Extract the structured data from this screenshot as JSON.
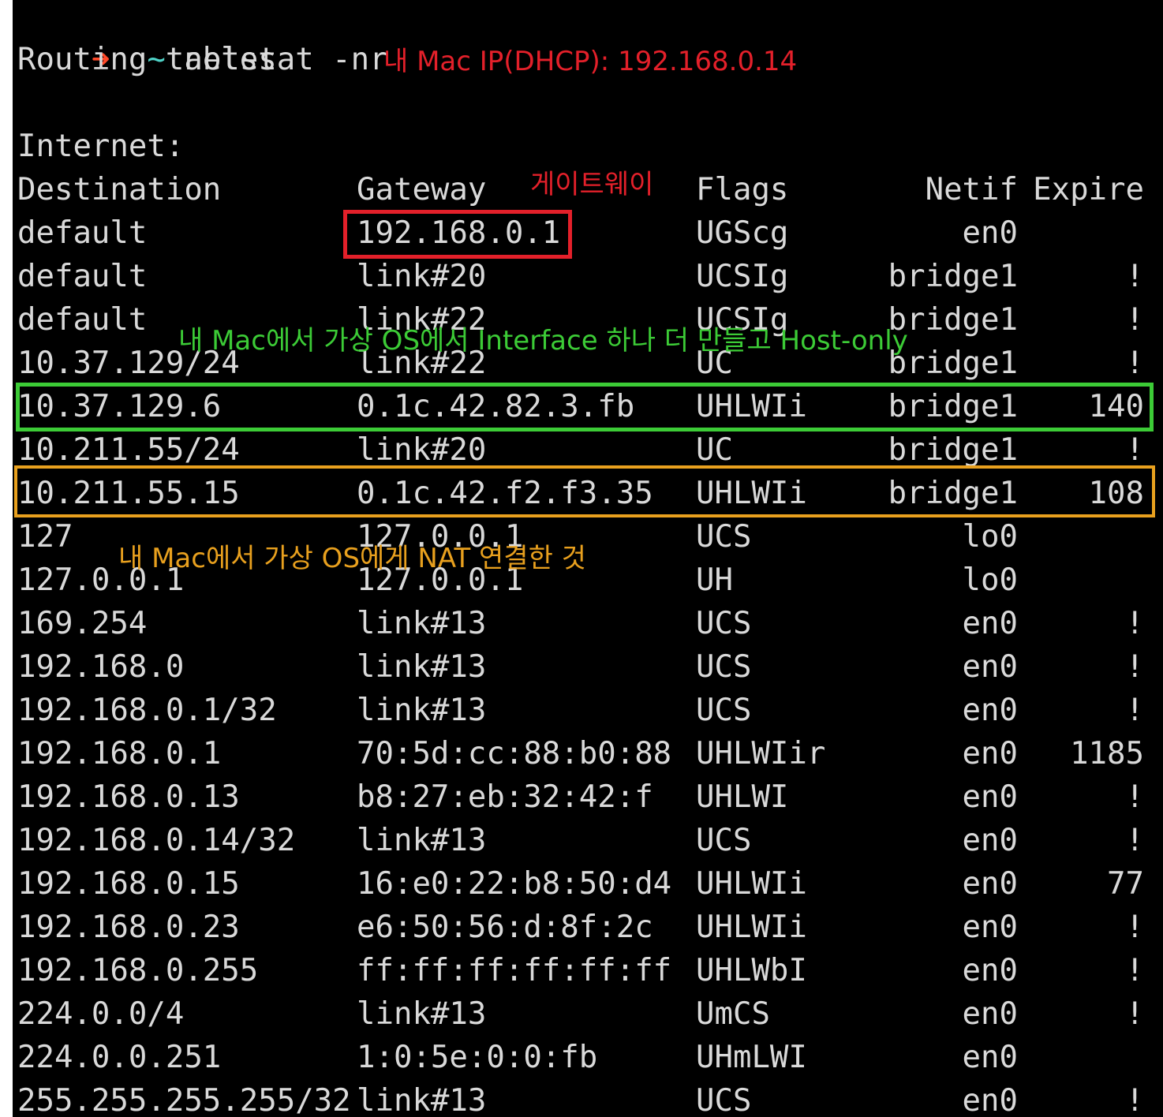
{
  "prompt": {
    "arrow": "➜",
    "tilde": "~",
    "command": "netstat -nr"
  },
  "heading": "Routing tables",
  "section": "Internet:",
  "columns": {
    "destination": "Destination",
    "gateway": "Gateway",
    "flags": "Flags",
    "netif": "Netif",
    "expire": "Expire"
  },
  "rows": [
    {
      "dest": "default",
      "gw": "192.168.0.1",
      "flags": "UGScg",
      "netif": "en0",
      "expire": ""
    },
    {
      "dest": "default",
      "gw": "link#20",
      "flags": "UCSIg",
      "netif": "bridge1",
      "expire": "!"
    },
    {
      "dest": "default",
      "gw": "link#22",
      "flags": "UCSIg",
      "netif": "bridge1",
      "expire": "!"
    },
    {
      "dest": "10.37.129/24",
      "gw": "link#22",
      "flags": "UC",
      "netif": "bridge1",
      "expire": "!"
    },
    {
      "dest": "10.37.129.6",
      "gw": "0.1c.42.82.3.fb",
      "flags": "UHLWIi",
      "netif": "bridge1",
      "expire": "140"
    },
    {
      "dest": "10.211.55/24",
      "gw": "link#20",
      "flags": "UC",
      "netif": "bridge1",
      "expire": "!"
    },
    {
      "dest": "10.211.55.15",
      "gw": "0.1c.42.f2.f3.35",
      "flags": "UHLWIi",
      "netif": "bridge1",
      "expire": "108"
    },
    {
      "dest": "127",
      "gw": "127.0.0.1",
      "flags": "UCS",
      "netif": "lo0",
      "expire": ""
    },
    {
      "dest": "127.0.0.1",
      "gw": "127.0.0.1",
      "flags": "UH",
      "netif": "lo0",
      "expire": ""
    },
    {
      "dest": "169.254",
      "gw": "link#13",
      "flags": "UCS",
      "netif": "en0",
      "expire": "!"
    },
    {
      "dest": "192.168.0",
      "gw": "link#13",
      "flags": "UCS",
      "netif": "en0",
      "expire": "!"
    },
    {
      "dest": "192.168.0.1/32",
      "gw": "link#13",
      "flags": "UCS",
      "netif": "en0",
      "expire": "!"
    },
    {
      "dest": "192.168.0.1",
      "gw": "70:5d:cc:88:b0:88",
      "flags": "UHLWIir",
      "netif": "en0",
      "expire": "1185"
    },
    {
      "dest": "192.168.0.13",
      "gw": "b8:27:eb:32:42:f",
      "flags": "UHLWI",
      "netif": "en0",
      "expire": "!"
    },
    {
      "dest": "192.168.0.14/32",
      "gw": "link#13",
      "flags": "UCS",
      "netif": "en0",
      "expire": "!"
    },
    {
      "dest": "192.168.0.15",
      "gw": "16:e0:22:b8:50:d4",
      "flags": "UHLWIi",
      "netif": "en0",
      "expire": "77"
    },
    {
      "dest": "192.168.0.23",
      "gw": "e6:50:56:d:8f:2c",
      "flags": "UHLWIi",
      "netif": "en0",
      "expire": "!"
    },
    {
      "dest": "192.168.0.255",
      "gw": "ff:ff:ff:ff:ff:ff",
      "flags": "UHLWbI",
      "netif": "en0",
      "expire": "!"
    },
    {
      "dest": "224.0.0/4",
      "gw": "link#13",
      "flags": "UmCS",
      "netif": "en0",
      "expire": "!"
    },
    {
      "dest": "224.0.0.251",
      "gw": "1:0:5e:0:0:fb",
      "flags": "UHmLWI",
      "netif": "en0",
      "expire": ""
    },
    {
      "dest": "255.255.255.255/32",
      "gw": "link#13",
      "flags": "UCS",
      "netif": "en0",
      "expire": "!"
    }
  ],
  "annotations": {
    "mac_ip": "내 Mac IP(DHCP): 192.168.0.14",
    "gateway": "게이트웨이",
    "host_only": "내 Mac에서 가상 OS에서 Interface 하나 더 만들고 Host-only",
    "nat": "내 Mac에서 가상 OS에게 NAT 연결한 것"
  },
  "colors": {
    "background": "#000000",
    "text": "#d9d9d9",
    "red": "#e3202a",
    "green": "#3ccb36",
    "orange": "#e8a01e"
  }
}
